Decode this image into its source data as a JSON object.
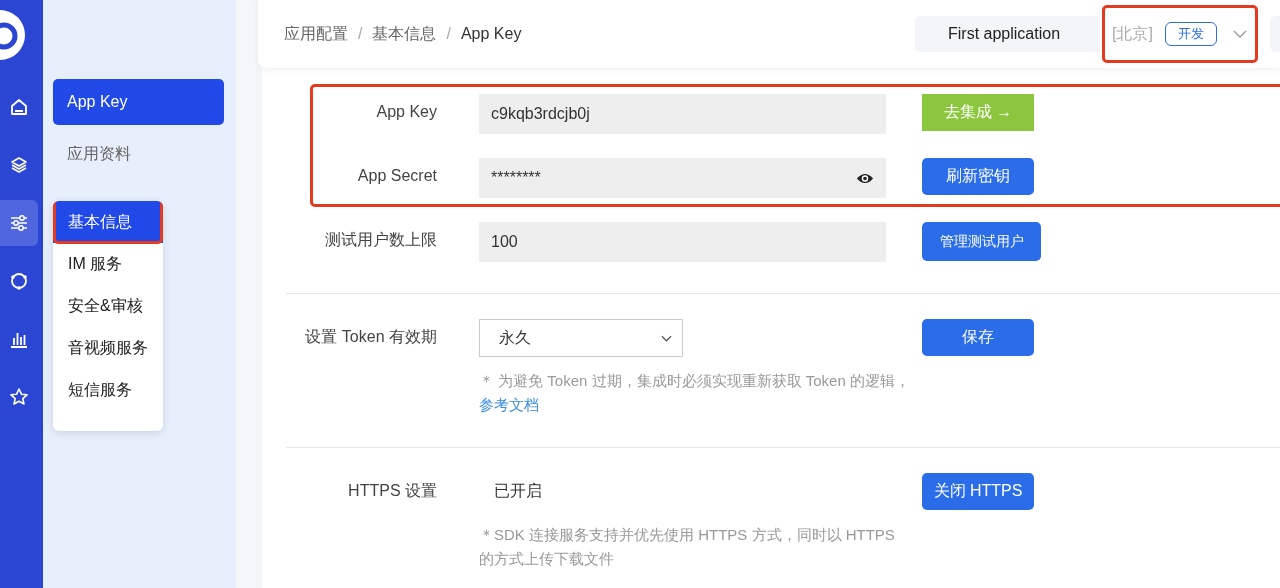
{
  "rail": {
    "items": [
      {
        "kind": "home",
        "selected": false
      },
      {
        "kind": "layers",
        "selected": false
      },
      {
        "kind": "sliders",
        "selected": true
      },
      {
        "kind": "cycle",
        "selected": false
      },
      {
        "kind": "chart",
        "selected": false
      },
      {
        "kind": "star",
        "selected": false
      }
    ]
  },
  "sidebar": {
    "items": [
      {
        "label": "App Key",
        "selected": true
      },
      {
        "label": "应用资料",
        "selected": false
      }
    ]
  },
  "flyout": {
    "items": [
      {
        "label": "基本信息",
        "selected": true,
        "highlighted": true
      },
      {
        "label": "IM 服务",
        "selected": false,
        "highlighted": false
      },
      {
        "label": "安全&审核",
        "selected": false,
        "highlighted": false
      },
      {
        "label": "音视频服务",
        "selected": false,
        "highlighted": false
      },
      {
        "label": "短信服务",
        "selected": false,
        "highlighted": false
      }
    ]
  },
  "header": {
    "breadcrumb": [
      "应用配置",
      "基本信息",
      "App Key"
    ],
    "separator": "/",
    "app": {
      "name": "First application",
      "region": "[北京]",
      "env": "开发",
      "highlighted": true
    }
  },
  "credentials": {
    "highlighted": true,
    "rows": [
      {
        "label": "App Key",
        "value": "c9kqb3rdcjb0j",
        "kind": "text",
        "button": "去集成 →",
        "color": "#8cc63f"
      },
      {
        "label": "App Secret",
        "value": "********",
        "kind": "secret",
        "button": "刷新密钥",
        "color": "#2b6de8"
      }
    ]
  },
  "test_users": {
    "label": "测试用户数上限",
    "value": "100",
    "button": "管理测试用户"
  },
  "token": {
    "label": "设置 Token 有效期",
    "value": "永久",
    "button": "保存",
    "note": "＊ 为避免 Token 过期，集成时必须实现重新获取 Token 的逻辑，",
    "link": "参考文档"
  },
  "https": {
    "label": "HTTPS 设置",
    "value": "已开启",
    "button": "关闭 HTTPS",
    "note": "＊SDK 连接服务支持并优先使用 HTTPS 方式，同时以 HTTPS 的方式上传下载文件"
  }
}
